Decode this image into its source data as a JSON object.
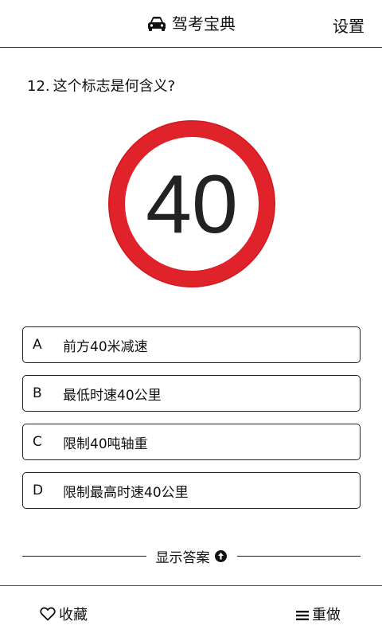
{
  "header": {
    "title": "驾考宝典",
    "settings_label": "设置"
  },
  "question": {
    "number": "12.",
    "text": "这个标志是何含义?"
  },
  "sign": {
    "speed_value": "40",
    "ring_color": "#e0222b",
    "digit_color": "#222222"
  },
  "options": [
    {
      "letter": "A",
      "text": "前方40米减速"
    },
    {
      "letter": "B",
      "text": "最低时速40公里"
    },
    {
      "letter": "C",
      "text": "限制40吨轴重"
    },
    {
      "letter": "D",
      "text": "限制最高时速40公里"
    }
  ],
  "answer": {
    "show_label": "显示答案"
  },
  "bottom_bar": {
    "favorite_label": "收藏",
    "redo_label": "重做"
  }
}
